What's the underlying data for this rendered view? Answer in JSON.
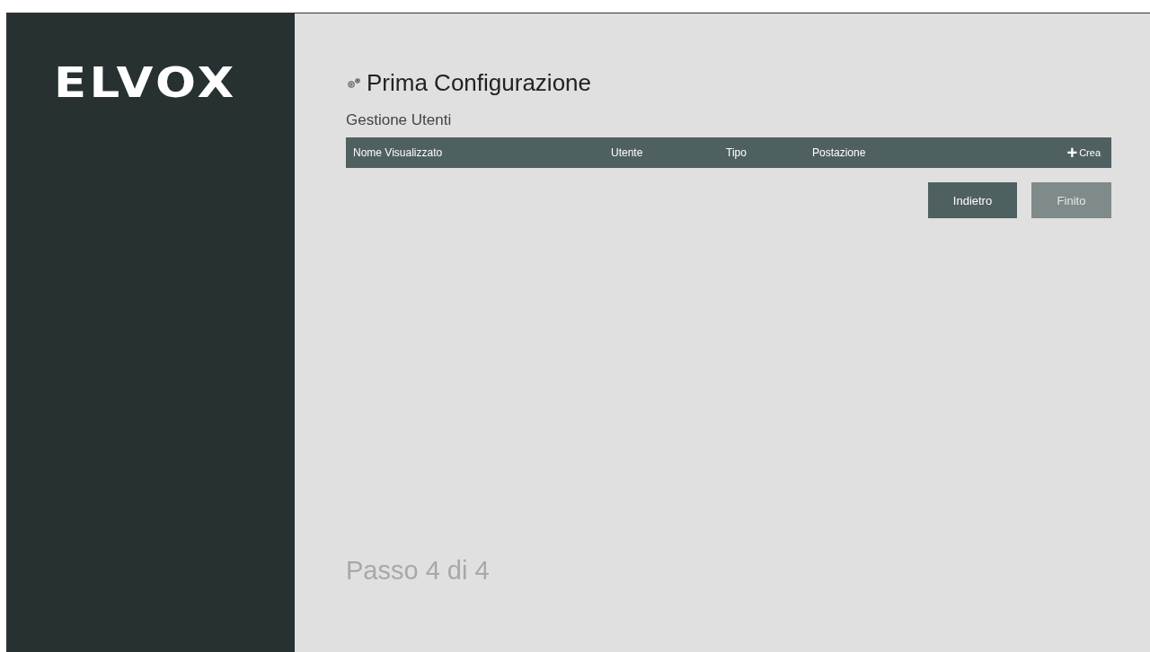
{
  "logo": "ELVOX",
  "page": {
    "title": "Prima Configurazione",
    "section": "Gestione Utenti"
  },
  "table": {
    "columns": [
      "Nome Visualizzato",
      "Utente",
      "Tipo",
      "Postazione"
    ],
    "create": {
      "icon": "+",
      "label": "Crea"
    }
  },
  "buttons": [
    {
      "label": "Indietro",
      "disabled": false
    },
    {
      "label": "Finito",
      "disabled": true
    }
  ],
  "step": "Passo 4 di 4"
}
